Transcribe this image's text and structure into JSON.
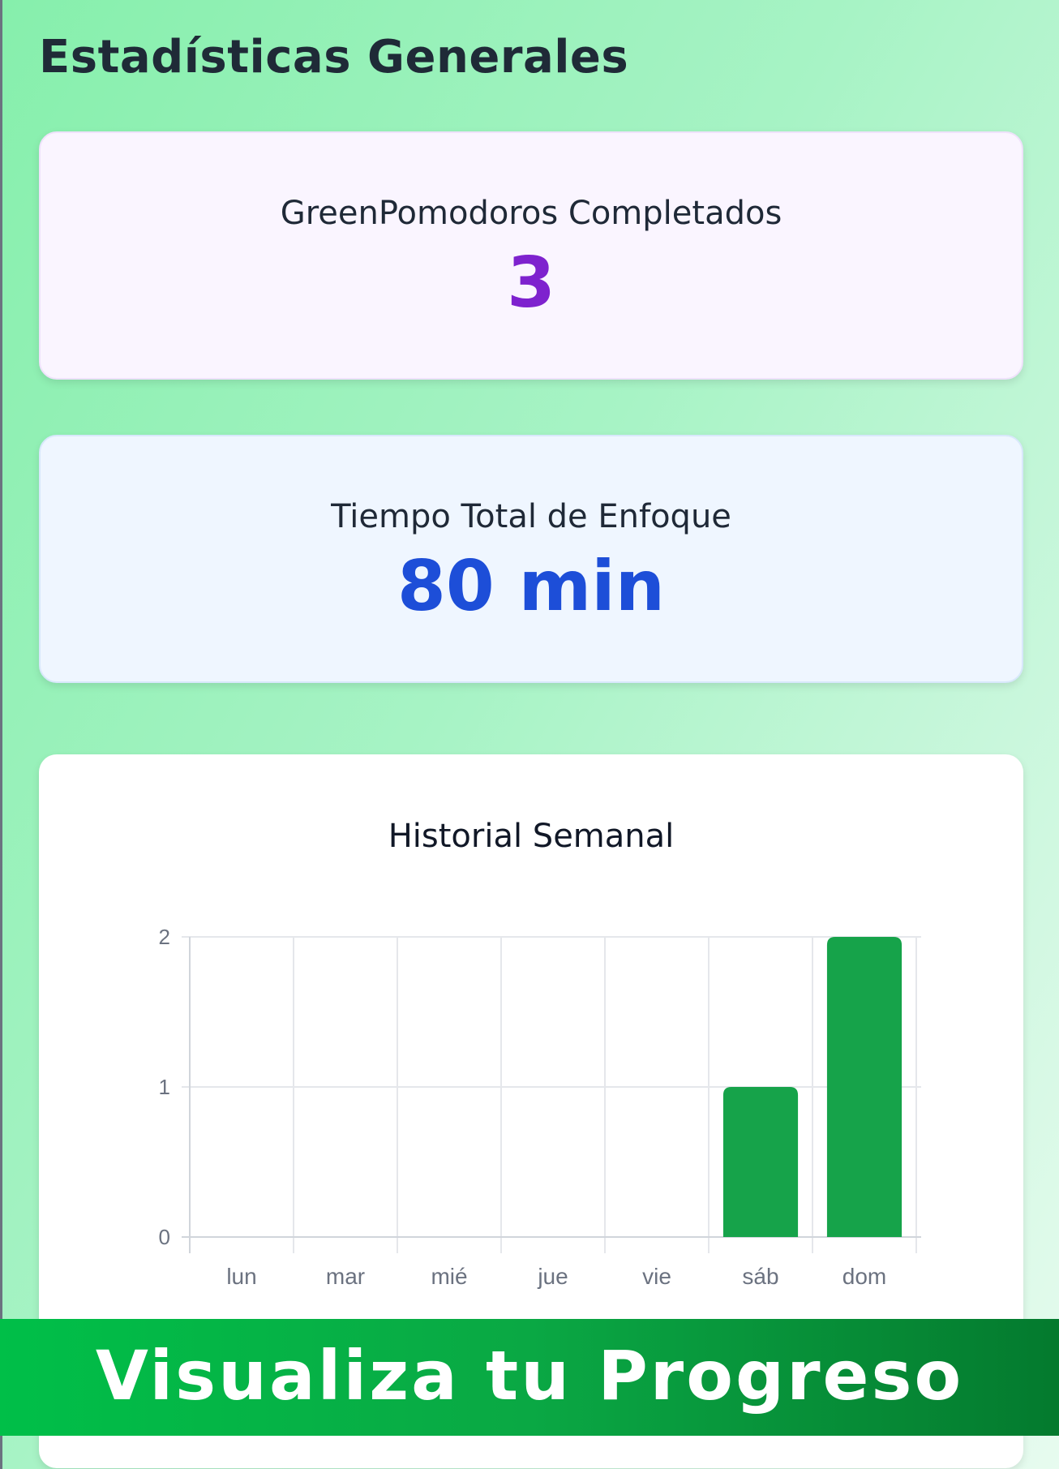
{
  "page": {
    "title": "Estadísticas Generales"
  },
  "stats": {
    "pomodoros": {
      "label": "GreenPomodoros Completados",
      "value": "3"
    },
    "focus_time": {
      "label": "Tiempo Total de Enfoque",
      "value": "80 min"
    }
  },
  "chart_data": {
    "type": "bar",
    "title": "Historial Semanal",
    "categories": [
      "lun",
      "mar",
      "mié",
      "jue",
      "vie",
      "sáb",
      "dom"
    ],
    "values": [
      0,
      0,
      0,
      0,
      0,
      1,
      2
    ],
    "ylim": [
      0,
      2
    ],
    "yticks": [
      0,
      1,
      2
    ],
    "grid": true,
    "bar_color": "#16a34a"
  },
  "banner": {
    "text": "Visualiza tu Progreso"
  }
}
